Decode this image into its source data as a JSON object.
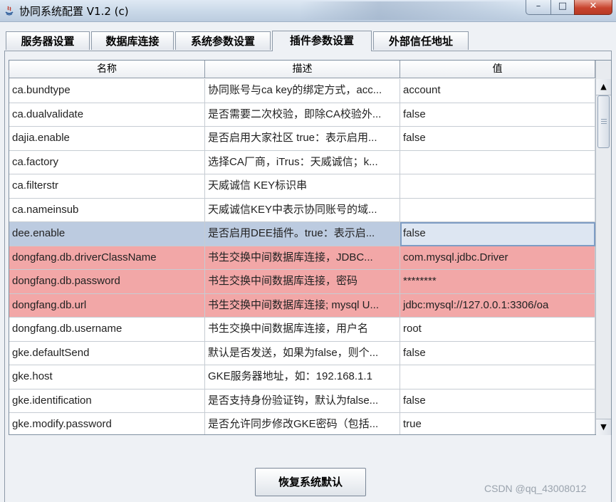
{
  "window": {
    "title": "协同系统配置 V1.2 (c)",
    "controls": {
      "minimize": "–",
      "maximize": "□",
      "close": "✕"
    }
  },
  "tabs": [
    {
      "label": "服务器设置",
      "active": false
    },
    {
      "label": "数据库连接",
      "active": false
    },
    {
      "label": "系统参数设置",
      "active": false
    },
    {
      "label": "插件参数设置",
      "active": true
    },
    {
      "label": "外部信任地址",
      "active": false
    }
  ],
  "table": {
    "columns": [
      "名称",
      "描述",
      "值"
    ],
    "rows": [
      {
        "name": "ca.bundtype",
        "desc": "协同账号与ca key的绑定方式，acc...",
        "value": "account",
        "state": "normal"
      },
      {
        "name": "ca.dualvalidate",
        "desc": "是否需要二次校验，即除CA校验外...",
        "value": "false",
        "state": "normal"
      },
      {
        "name": "dajia.enable",
        "desc": "是否启用大家社区 true：表示启用...",
        "value": "false",
        "state": "normal"
      },
      {
        "name": "ca.factory",
        "desc": "选择CA厂商，iTrus：天威诚信；k...",
        "value": "",
        "state": "normal"
      },
      {
        "name": "ca.filterstr",
        "desc": "天威诚信 KEY标识串",
        "value": "",
        "state": "normal"
      },
      {
        "name": "ca.nameinsub",
        "desc": "天威诚信KEY中表示协同账号的域...",
        "value": "",
        "state": "normal"
      },
      {
        "name": "dee.enable",
        "desc": "是否启用DEE插件。true：表示启...",
        "value": "false",
        "state": "selected"
      },
      {
        "name": "dongfang.db.driverClassName",
        "desc": "书生交换中间数据库连接，JDBC...",
        "value": "com.mysql.jdbc.Driver",
        "state": "error"
      },
      {
        "name": "dongfang.db.password",
        "desc": "书生交换中间数据库连接，密码",
        "value": "********",
        "state": "error"
      },
      {
        "name": "dongfang.db.url",
        "desc": "书生交换中间数据库连接; mysql U...",
        "value": "jdbc:mysql://127.0.0.1:3306/oa",
        "state": "error"
      },
      {
        "name": "dongfang.db.username",
        "desc": "书生交换中间数据库连接，用户名",
        "value": "root",
        "state": "normal"
      },
      {
        "name": "gke.defaultSend",
        "desc": "默认是否发送，如果为false，则个...",
        "value": "false",
        "state": "normal"
      },
      {
        "name": "gke.host",
        "desc": "GKE服务器地址，如：192.168.1.1",
        "value": "",
        "state": "normal"
      },
      {
        "name": "gke.identification",
        "desc": "是否支持身份验证钩，默认为false...",
        "value": "false",
        "state": "normal"
      },
      {
        "name": "gke.modify.password",
        "desc": "是否允许同步修改GKE密码（包括...",
        "value": "true",
        "state": "normal"
      }
    ]
  },
  "scrollbar": {
    "up": "▲",
    "down": "▼"
  },
  "footer": {
    "restore_label": "恢复系统默认",
    "watermark": "CSDN @qq_43008012"
  },
  "colors": {
    "error_row": "#f2a7a7",
    "selected_row": "#bccbe0",
    "background": "#eef1f5"
  }
}
